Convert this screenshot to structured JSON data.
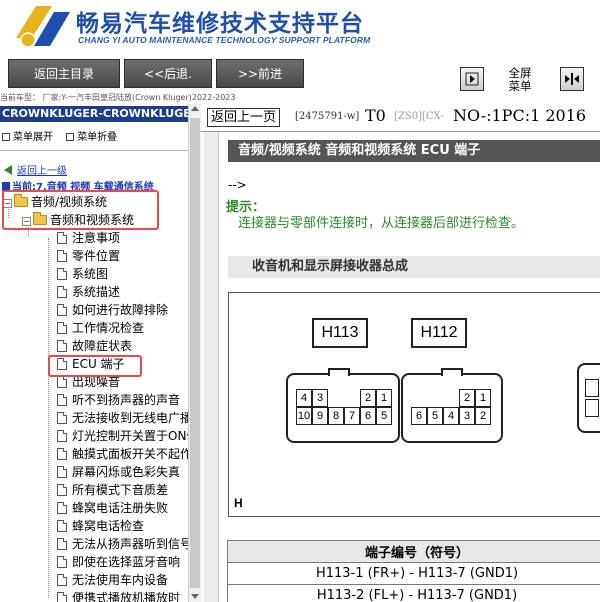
{
  "header": {
    "title": "畅易汽车维修技术支持平台",
    "subtitle": "CHANG YI AUTO MAINTENANCE TECHNOLOGY SUPPORT PLATFORM"
  },
  "toolbar": {
    "home_label": "返回主目录",
    "back_label": "<<后退.",
    "forward_label": ">>前进",
    "fullscreen_label_line1": "全屏",
    "fullscreen_label_line2": "菜单"
  },
  "car_model": "当前车型： 厂家:Y-一汽丰田皇冠陆放(Crown Kluger)2022-2023",
  "sidebar": {
    "header": "CROWNKLUGER-CROWNKLUGER",
    "expand_label": "菜单展开",
    "collapse_label": "菜单折叠",
    "back_link": "返回上一级",
    "current": "当前:7.音频 视频 车载通信系统",
    "folder_level1": "音频/视频系统",
    "folder_level2": "音频和视频系统",
    "items": [
      "注意事项",
      "零件位置",
      "系统图",
      "系统描述",
      "如何进行故障排除",
      "工作情况检查",
      "故障症状表",
      "ECU 端子",
      "出现噪音",
      "听不到扬声器的声音",
      "无法接收到无线电广播",
      "灯光控制开关置于ON位置",
      "触摸式面板开关不起作用",
      "屏幕闪烁或色彩失真",
      "所有模式下音质差",
      "蜂窝电话注册失败",
      "蜂窝电话检查",
      "无法从扬声器听到信号",
      "即使在选择蓝牙音响",
      "无法使用车内设备",
      "便携式播放机播放时"
    ]
  },
  "content": {
    "return_label": "返回上一页",
    "doc_id": "[2475791-w]",
    "doc_t0": "T0",
    "doc_zs": "[ZS0][CX-",
    "doc_no": "NO-:1PC:1 2016",
    "section_title": "音频/视频系统  音频和视频系统  ECU 端子",
    "comment_arrow": "-->",
    "hint_title": "提示：",
    "hint_text": "连接器与零部件连接时，从连接器后部进行检查。",
    "sub_title": "收音机和显示屏接收器总成",
    "diagram": {
      "connector_a": "H113",
      "connector_b": "H112",
      "pins_a_top": [
        "4",
        "3",
        "",
        "",
        "2",
        "1"
      ],
      "pins_a_bottom": [
        "10",
        "9",
        "8",
        "7",
        "6",
        "5"
      ],
      "pins_b_top": [
        "",
        "",
        "",
        "2",
        "1"
      ],
      "pins_b_bottom": [
        "6",
        "5",
        "4",
        "3",
        "2"
      ],
      "footer": "H"
    },
    "table": {
      "header": "端子编号（符号）",
      "rows": [
        "H113-1 (FR+) - H113-7 (GND1)",
        "H113-2 (FL+) - H113-7 (GND1)"
      ]
    }
  }
}
